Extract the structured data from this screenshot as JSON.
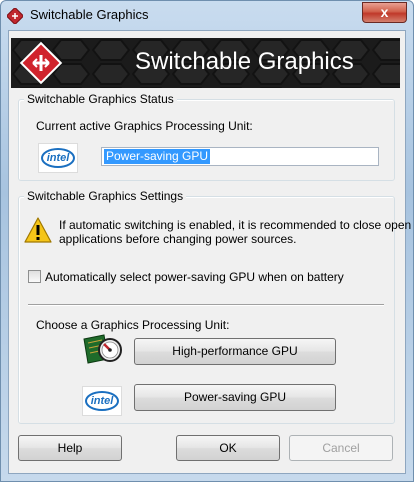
{
  "window": {
    "title": "Switchable Graphics",
    "close_label": "x"
  },
  "banner": {
    "title": "Switchable Graphics"
  },
  "status_group": {
    "legend": "Switchable Graphics Status",
    "current_label": "Current active Graphics Processing Unit:",
    "current_gpu": "Power-saving GPU",
    "gpu_icon": "intel-logo",
    "intel_text": "intel"
  },
  "settings_group": {
    "legend": "Switchable Graphics Settings",
    "warning_icon": "warning-icon",
    "warning_line1": "If automatic switching is enabled, it is recommended to close open",
    "warning_line2": "applications before changing power sources.",
    "auto_switch_label": "Automatically select power-saving GPU when on battery",
    "auto_switch_checked": false,
    "choose_label": "Choose a Graphics Processing Unit:",
    "high_perf_button": "High-performance GPU",
    "power_saving_button": "Power-saving GPU",
    "intel_text": "intel"
  },
  "footer": {
    "help_label": "Help",
    "ok_label": "OK",
    "cancel_label": "Cancel"
  },
  "colors": {
    "selection": "#3399ff",
    "intel_blue": "#1a6fc0",
    "close_red": "#c0382a"
  }
}
